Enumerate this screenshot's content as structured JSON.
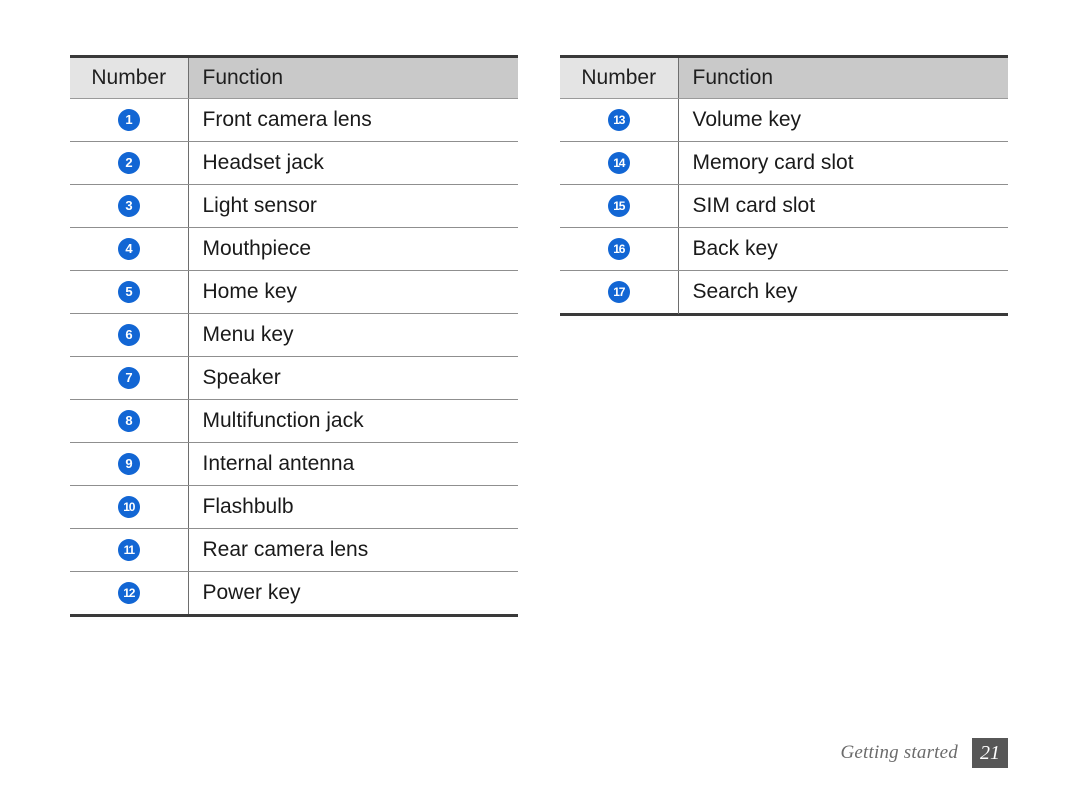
{
  "document": {
    "section_label": "Getting started",
    "page_number": "21"
  },
  "colors": {
    "badge_blue": "#1266d4",
    "header_number_bg": "#e4e4e4",
    "header_function_bg": "#c9c9c9",
    "rule_dark": "#3a3a3a",
    "rule_light": "#8f8f8f",
    "page_box_bg": "#575757",
    "footer_text": "#6b6b6b"
  },
  "tables": [
    {
      "id": "left",
      "headers": {
        "number": "Number",
        "function": "Function"
      },
      "rows": [
        {
          "number": "1",
          "function": "Front camera lens"
        },
        {
          "number": "2",
          "function": "Headset jack"
        },
        {
          "number": "3",
          "function": "Light sensor"
        },
        {
          "number": "4",
          "function": "Mouthpiece"
        },
        {
          "number": "5",
          "function": "Home key"
        },
        {
          "number": "6",
          "function": "Menu key"
        },
        {
          "number": "7",
          "function": "Speaker"
        },
        {
          "number": "8",
          "function": "Multifunction jack"
        },
        {
          "number": "9",
          "function": "Internal antenna"
        },
        {
          "number": "10",
          "function": "Flashbulb"
        },
        {
          "number": "11",
          "function": "Rear camera lens"
        },
        {
          "number": "12",
          "function": "Power key"
        }
      ]
    },
    {
      "id": "right",
      "headers": {
        "number": "Number",
        "function": "Function"
      },
      "rows": [
        {
          "number": "13",
          "function": "Volume key"
        },
        {
          "number": "14",
          "function": "Memory card slot"
        },
        {
          "number": "15",
          "function": "SIM card slot"
        },
        {
          "number": "16",
          "function": "Back key"
        },
        {
          "number": "17",
          "function": "Search key"
        }
      ]
    }
  ]
}
